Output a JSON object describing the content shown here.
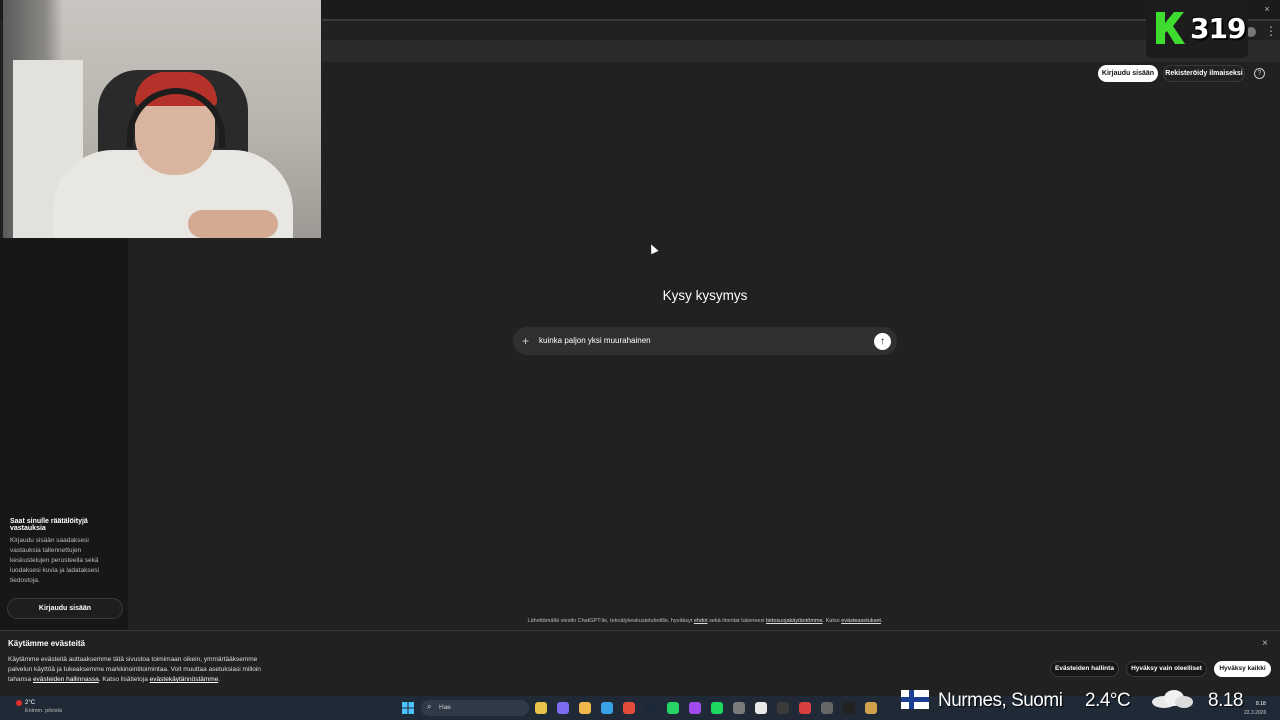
{
  "overlay": {
    "counter_letter": "K",
    "counter_value": "319",
    "accent_color": "#3ddc2e"
  },
  "header": {
    "login_label": "Kirjaudu sisään",
    "register_label": "Rekisteröidy ilmaiseksi",
    "help_icon": "?"
  },
  "sidebar": {
    "promo_title": "Saat sinulle räätälöityjä vastauksia",
    "promo_body": "Kirjaudu sisään saadaksesi vastauksia tallennettujen keskustelujen perusteella sekä luodaksesi kuvia ja ladataksesi tiedostoja.",
    "login_label": "Kirjaudu sisään"
  },
  "main": {
    "title": "Kysy kysymys",
    "prompt_text": "kuinka paljon yksi muurahainen",
    "plus_icon": "+",
    "send_icon": "↑"
  },
  "disclaimer": {
    "prefix": "Lähettämällä viestin ChatGPT:lle, tekoälykeskustelubotille, hyväksyt ",
    "terms_link": "ehdot",
    "middle": " sekä ilmoitat lukeneesi ",
    "privacy_link": "tietosuojakäytäntömme",
    "suffix": ". Katso ",
    "cookie_link": "evästeasetukset",
    "end": "."
  },
  "cookies": {
    "title": "Käytämme evästeitä",
    "body_1": "Käytämme evästeitä auttaaksemme tätä sivustoa toimimaan oikein, ymmärtääksemme palvelun käyttöä ja tukeaksemme markkinointitoimintaa. Voit muuttaa asetuksiasi milloin tahansa ",
    "manage_link": "evästeiden hallinnassa",
    "body_2": ". Katso lisätietoja ",
    "policy_link": "evästekäytännöstämme",
    "body_3": ".",
    "close_icon": "×",
    "manage_label": "Evästeiden hallinta",
    "essential_label": "Hyväksy vain oleelliset",
    "accept_label": "Hyväksy kaikki"
  },
  "taskbar": {
    "weather_temp": "2°C",
    "weather_desc": "Enimm. pilvistä",
    "search_placeholder": "Hae",
    "icons": [
      "file-explorer-icon",
      "copilot-icon",
      "folder-icon",
      "edge-icon",
      "chrome-icon",
      "steam-icon",
      "whatsapp-icon",
      "messenger-icon",
      "spotify-icon",
      "settings-icon",
      "capture-icon",
      "xbox-icon",
      "app-icon",
      "obs-icon",
      "x-icon",
      "notepad-icon"
    ],
    "sys_time": "8.18",
    "sys_date": "22.3.2026"
  },
  "location_overlay": {
    "location": "Nurmes, Suomi",
    "temperature": "2.4°C",
    "time": "8.18"
  }
}
